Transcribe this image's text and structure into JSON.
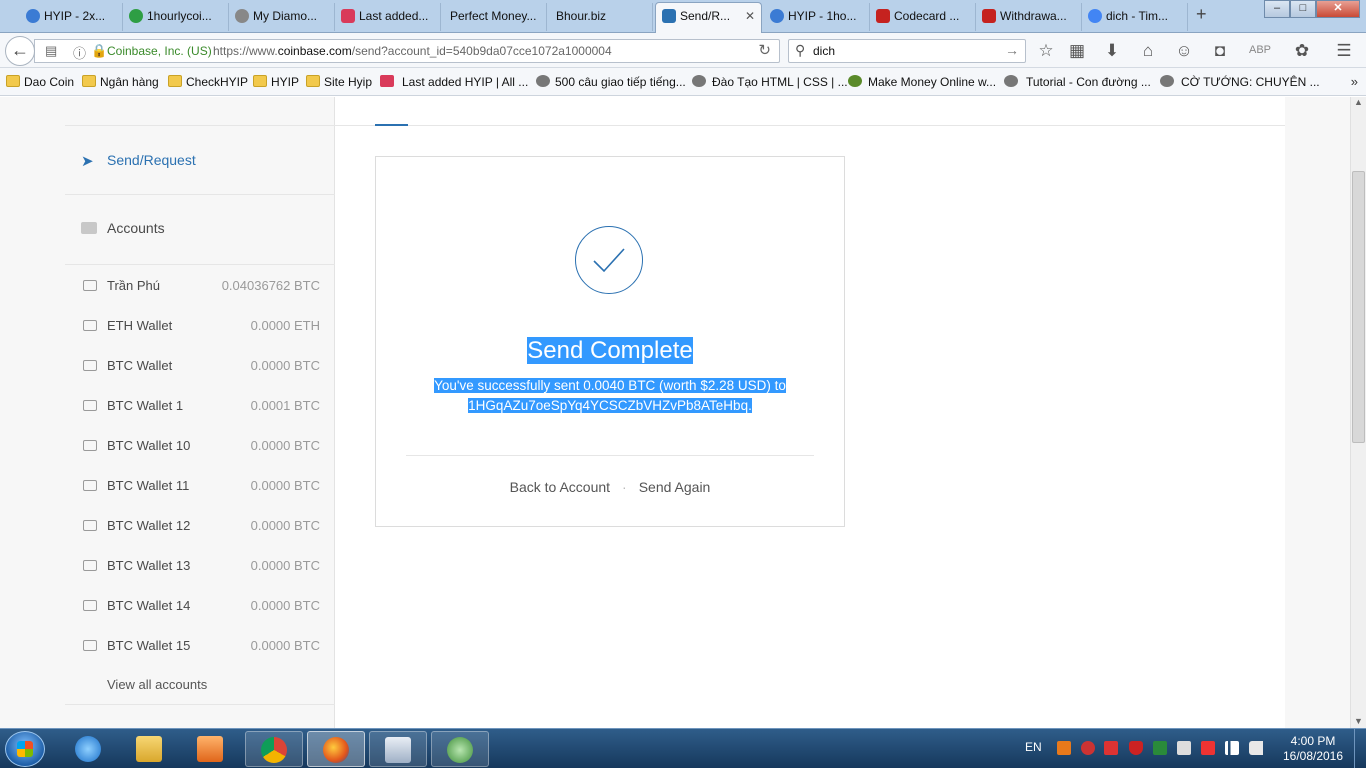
{
  "browser": {
    "tabs": [
      {
        "label": "HYIP - 2x...",
        "color": "#3b7bd4"
      },
      {
        "label": "1hourlycoi...",
        "color": "#2e9e44"
      },
      {
        "label": "My Diamo...",
        "color": "#888888"
      },
      {
        "label": "Last added...",
        "color": "#d93a5a"
      },
      {
        "label": "Perfect Money...",
        "color": ""
      },
      {
        "label": "Bhour.biz",
        "color": ""
      },
      {
        "label": "Send/R...",
        "color": "#2b71b1"
      },
      {
        "label": "HYIP - 1ho...",
        "color": "#3b7bd4"
      },
      {
        "label": "Codecard ...",
        "color": "#c5221f"
      },
      {
        "label": "Withdrawa...",
        "color": "#c5221f"
      },
      {
        "label": "dich - Tim...",
        "color": "#4285f4"
      }
    ],
    "active_tab_close": "✕",
    "new_tab": "+",
    "window_buttons": {
      "minimize": "‒",
      "maximize": "□",
      "close": "✕"
    },
    "nav": {
      "back": "←",
      "identity": "Coinbase, Inc. (US)",
      "url_prefix": "https://www.",
      "url_domain": "coinbase.com",
      "url_suffix": "/send?account_id=540b9da07cce1072a1000004",
      "reload": "↻",
      "search_query": "dich",
      "search_go": "→"
    },
    "bookmarks": [
      {
        "label": "Dao Coin",
        "icon": "folder"
      },
      {
        "label": "Ngân hàng",
        "icon": "folder"
      },
      {
        "label": "CheckHYIP",
        "icon": "folder"
      },
      {
        "label": "HYIP",
        "icon": "folder"
      },
      {
        "label": "Site Hyip",
        "icon": "folder"
      },
      {
        "label": "Last added HYIP | All ...",
        "icon": "red"
      },
      {
        "label": "500 câu giao tiếp tiếng...",
        "icon": "globe"
      },
      {
        "label": "Đào Tạo HTML | CSS | ...",
        "icon": "globe"
      },
      {
        "label": "Make Money Online w...",
        "icon": "green"
      },
      {
        "label": "Tutorial - Con đường ...",
        "icon": "globe"
      },
      {
        "label": "CỜ TƯỚNG: CHUYÊN ...",
        "icon": "globe"
      }
    ],
    "bookmarks_more": "»"
  },
  "sidebar": {
    "send_request": "Send/Request",
    "accounts_heading": "Accounts",
    "accounts": [
      {
        "name": "Trần Phú",
        "balance": "0.04036762 BTC"
      },
      {
        "name": "ETH Wallet",
        "balance": "0.0000 ETH"
      },
      {
        "name": "BTC Wallet",
        "balance": "0.0000 BTC"
      },
      {
        "name": "BTC Wallet 1",
        "balance": "0.0001 BTC"
      },
      {
        "name": "BTC Wallet 10",
        "balance": "0.0000 BTC"
      },
      {
        "name": "BTC Wallet 11",
        "balance": "0.0000 BTC"
      },
      {
        "name": "BTC Wallet 12",
        "balance": "0.0000 BTC"
      },
      {
        "name": "BTC Wallet 13",
        "balance": "0.0000 BTC"
      },
      {
        "name": "BTC Wallet 14",
        "balance": "0.0000 BTC"
      },
      {
        "name": "BTC Wallet 15",
        "balance": "0.0000 BTC"
      }
    ],
    "view_all": "View all accounts"
  },
  "confirmation": {
    "title": "Send Complete",
    "message_line1": "You've successfully sent 0.0040 BTC (worth $2.28 USD) to",
    "message_line2": "1HGqAZu7oeSpYq4YCSCZbVHZvPb8ATeHbq.",
    "back_to_account": "Back to Account",
    "separator": "·",
    "send_again": "Send Again"
  },
  "taskbar": {
    "language": "EN",
    "time": "4:00 PM",
    "date": "16/08/2016",
    "apps": [
      "internet-explorer",
      "file-explorer",
      "media-player",
      "chrome",
      "firefox",
      "calculator",
      "browser"
    ]
  },
  "colors": {
    "accent": "#2b71b1",
    "selection": "#3399ff"
  }
}
